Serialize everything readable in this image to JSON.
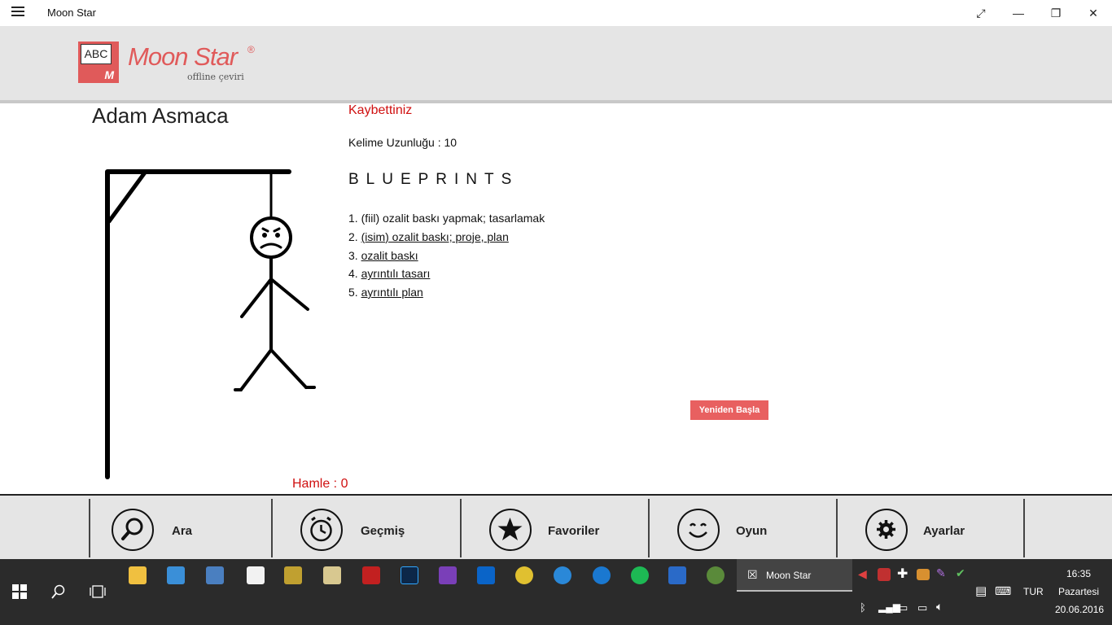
{
  "window": {
    "title": "Moon Star"
  },
  "logo": {
    "box_text": "ABC",
    "box_letter": "M",
    "name": "Moon Star",
    "reg": "®",
    "subtitle": "offline çeviri"
  },
  "game": {
    "title": "Adam Asmaca",
    "status": "Kaybettiniz",
    "word_length_label": "Kelime Uzunluğu  : 10",
    "word": "BLUEPRINTS",
    "definitions": [
      {
        "num": "1. ",
        "text": "(fiil) ozalit baskı yapmak; tasarlamak",
        "link": false
      },
      {
        "num": "2. ",
        "text": "(isim) ozalit baskı; proje, plan",
        "link": true
      },
      {
        "num": "3. ",
        "text": "ozalit baskı",
        "link": true
      },
      {
        "num": "4. ",
        "text": "ayrıntılı tasarı",
        "link": true
      },
      {
        "num": "5. ",
        "text": "ayrıntılı plan",
        "link": true
      }
    ],
    "restart_label": "Yeniden Başla",
    "moves_label": "Hamle : 0"
  },
  "nav": [
    {
      "label": "Ara",
      "icon": "search-icon"
    },
    {
      "label": "Geçmiş",
      "icon": "alarm-clock-icon"
    },
    {
      "label": "Favoriler",
      "icon": "star-icon"
    },
    {
      "label": "Oyun",
      "icon": "smiley-icon"
    },
    {
      "label": "Ayarlar",
      "icon": "gear-icon"
    }
  ],
  "taskbar": {
    "active_app": "Moon Star",
    "lang": "TUR",
    "time": "16:35",
    "day": "Pazartesi",
    "date": "20.06.2016"
  },
  "colors": {
    "accent": "#e05a5a",
    "status_red": "#d01010",
    "header_bg": "#e5e5e5",
    "taskbar_bg": "#2b2b2b"
  }
}
